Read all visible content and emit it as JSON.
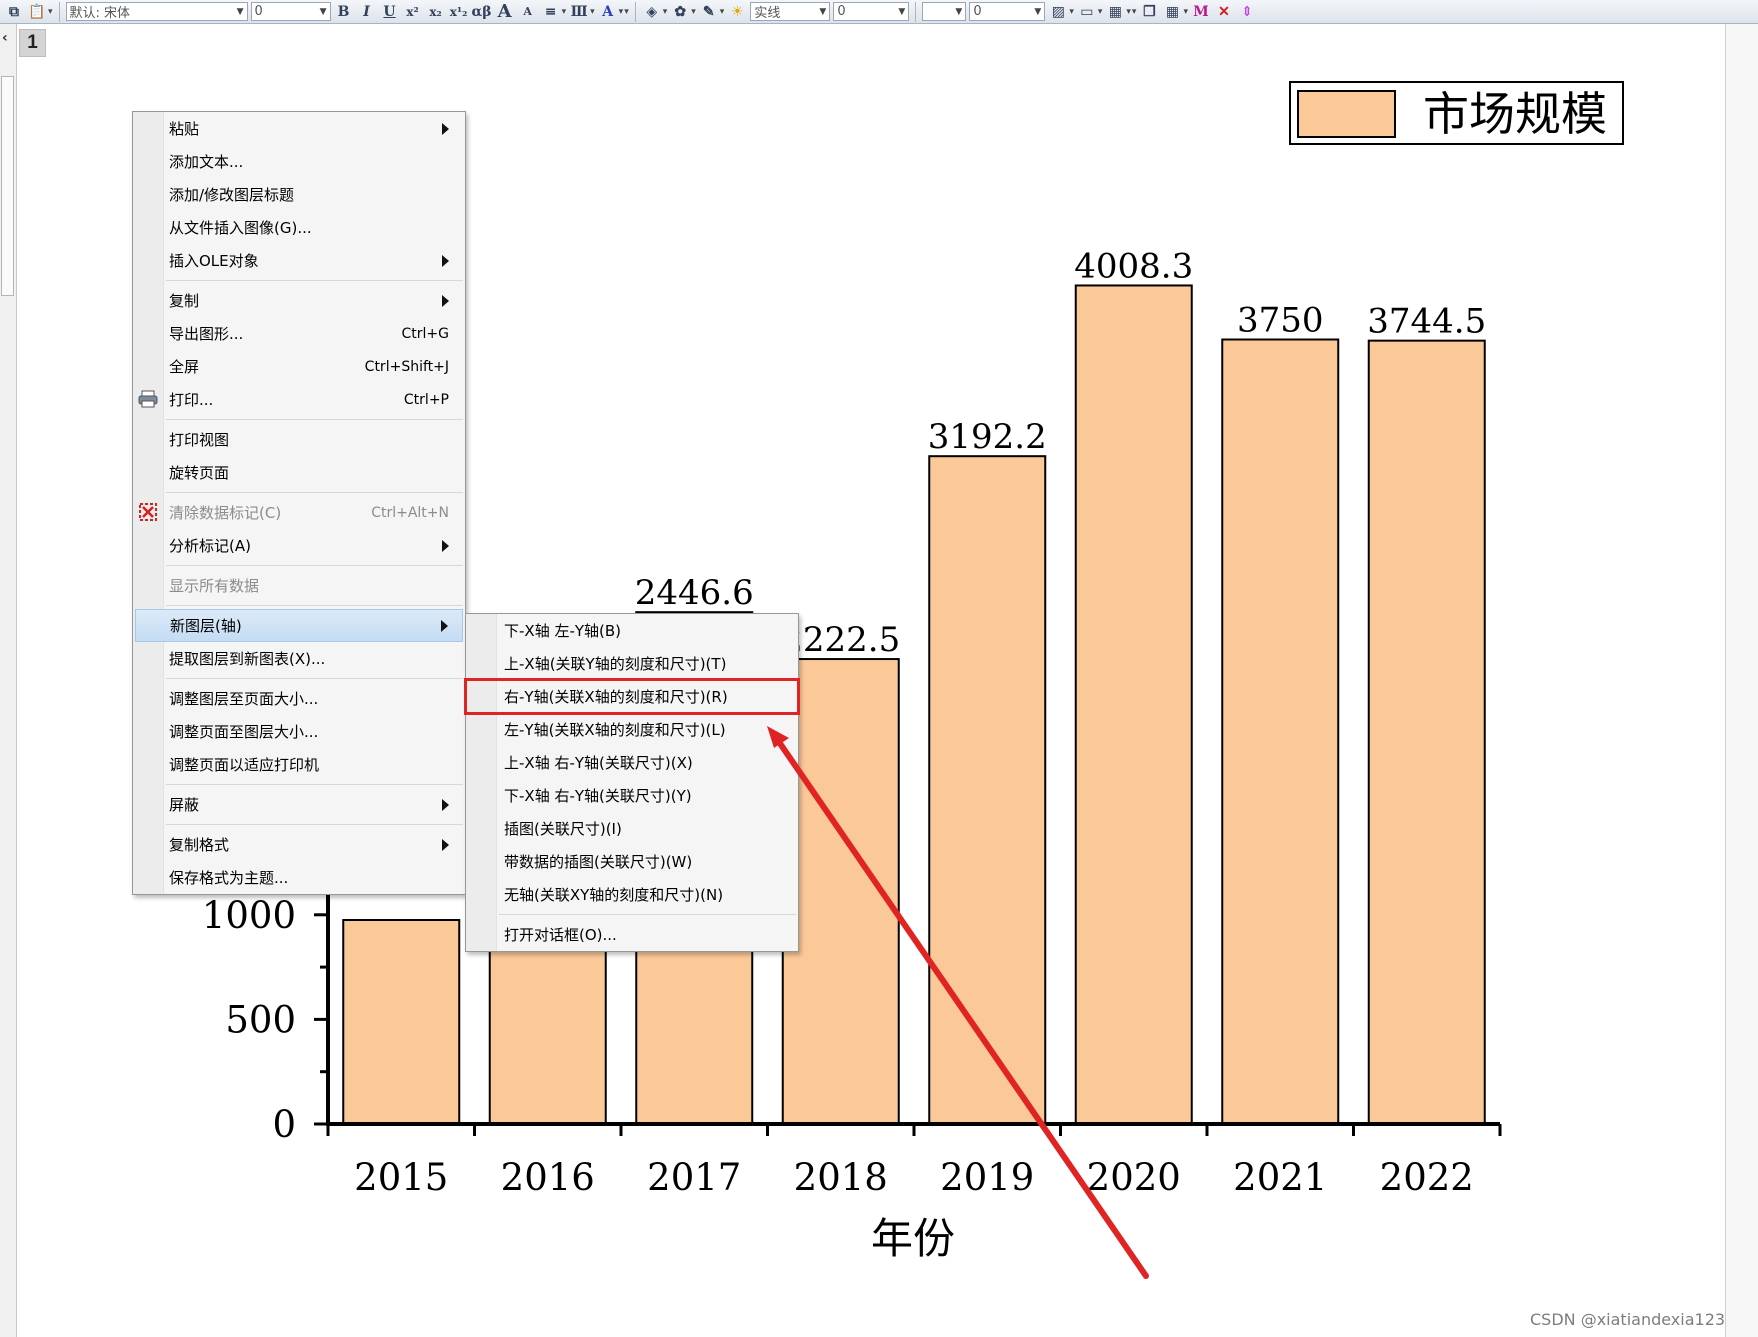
{
  "toolbar": {
    "font_name": "默认: 宋体",
    "font_size": "0",
    "line_style": "实线",
    "line_width": "0",
    "fill_value": "0",
    "greek_label": "αβ",
    "bold": "B",
    "italic": "I",
    "underline": "U",
    "superscript": "x²",
    "subscript": "x₂",
    "supsub": "x¹₂",
    "font_big": "A",
    "font_small": "A"
  },
  "layer_tab": {
    "label": "1"
  },
  "chart_data": {
    "type": "bar",
    "categories": [
      "2015",
      "2016",
      "2017",
      "2018",
      "2019",
      "2020",
      "2021",
      "2022"
    ],
    "values": [
      null,
      null,
      2446.6,
      2222.5,
      3192.2,
      4008.3,
      3750,
      3744.5
    ],
    "value_labels": [
      "",
      "",
      "2446.6",
      "2222.5",
      "3192.2",
      "4008.3",
      "3750",
      "3744.5"
    ],
    "legend": [
      "市场规模"
    ],
    "xlabel": "年份",
    "ylabel": "",
    "yticks": [
      "0",
      "500",
      "1000"
    ],
    "ylim": [
      0,
      5200
    ],
    "bar_color": "#FBC898",
    "legend_position": "top-right"
  },
  "context_menu": {
    "items": [
      {
        "label": "粘贴",
        "submenu": true
      },
      {
        "label": "添加文本..."
      },
      {
        "label": "添加/修改图层标题"
      },
      {
        "label": "从文件插入图像(G)..."
      },
      {
        "label": "插入OLE对象",
        "submenu": true
      },
      {
        "label": "复制",
        "submenu": true
      },
      {
        "label": "导出图形...",
        "shortcut": "Ctrl+G"
      },
      {
        "label": "全屏",
        "shortcut": "Ctrl+Shift+J"
      },
      {
        "label": "打印...",
        "shortcut": "Ctrl+P"
      },
      {
        "label": "打印视图"
      },
      {
        "label": "旋转页面"
      },
      {
        "label": "清除数据标记(C)",
        "shortcut": "Ctrl+Alt+N"
      },
      {
        "label": "分析标记(A)",
        "submenu": true
      },
      {
        "label": "显示所有数据"
      },
      {
        "label": "新图层(轴)",
        "submenu": true
      },
      {
        "label": "提取图层到新图表(X)..."
      },
      {
        "label": "调整图层至页面大小..."
      },
      {
        "label": "调整页面至图层大小..."
      },
      {
        "label": "调整页面以适应打印机"
      },
      {
        "label": "屏蔽",
        "submenu": true
      },
      {
        "label": "复制格式",
        "submenu": true
      },
      {
        "label": "保存格式为主题..."
      }
    ]
  },
  "new_layer_submenu": {
    "items": [
      {
        "label": "下-X轴 左-Y轴(B)"
      },
      {
        "label": "上-X轴(关联Y轴的刻度和尺寸)(T)"
      },
      {
        "label": "右-Y轴(关联X轴的刻度和尺寸)(R)"
      },
      {
        "label": "左-Y轴(关联X轴的刻度和尺寸)(L)"
      },
      {
        "label": "上-X轴 右-Y轴(关联尺寸)(X)"
      },
      {
        "label": "下-X轴 右-Y轴(关联尺寸)(Y)"
      },
      {
        "label": "插图(关联尺寸)(I)"
      },
      {
        "label": "带数据的插图(关联尺寸)(W)"
      },
      {
        "label": "无轴(关联XY轴的刻度和尺寸)(N)"
      },
      {
        "label": "打开对话框(O)..."
      }
    ]
  },
  "annotation": {
    "color": "#E02424"
  },
  "watermark": "CSDN @xiatiandexia123"
}
